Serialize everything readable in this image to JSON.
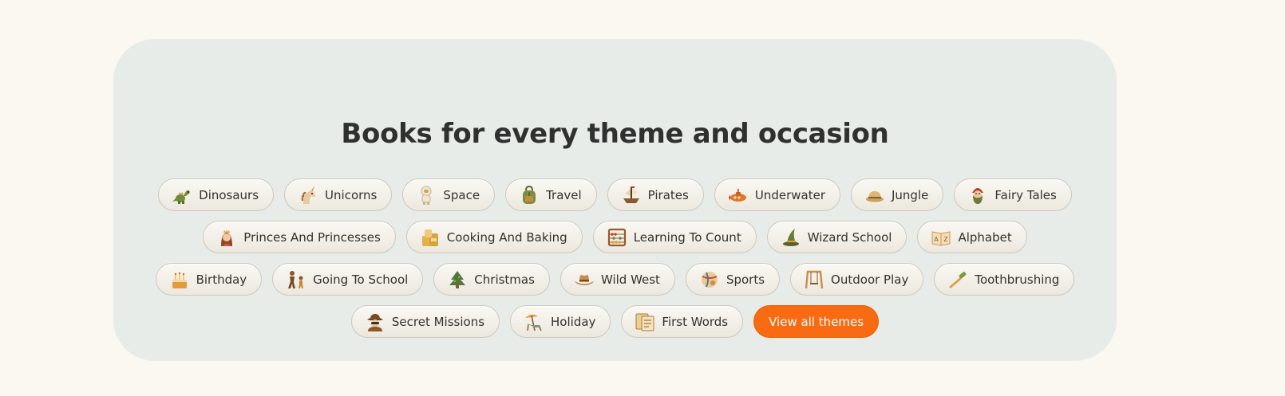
{
  "section": {
    "title": "Books for every theme and occasion",
    "cta_label": "View all themes"
  },
  "colors": {
    "page_background": "#fbf7f1",
    "panel_background": "#e7ece8",
    "title_text": "#2f3131",
    "chip_text": "#35312c",
    "cta_background": "#f96b12"
  },
  "rows": [
    [
      {
        "label": "Dinosaurs",
        "icon": "dinosaur-icon"
      },
      {
        "label": "Unicorns",
        "icon": "unicorn-icon"
      },
      {
        "label": "Space",
        "icon": "astronaut-icon"
      },
      {
        "label": "Travel",
        "icon": "backpack-icon"
      },
      {
        "label": "Pirates",
        "icon": "pirate-ship-icon"
      },
      {
        "label": "Underwater",
        "icon": "submarine-icon"
      },
      {
        "label": "Jungle",
        "icon": "safari-hat-icon"
      },
      {
        "label": "Fairy Tales",
        "icon": "bearded-dwarf-icon"
      }
    ],
    [
      {
        "label": "Princes And Princesses",
        "icon": "princess-icon"
      },
      {
        "label": "Cooking And Baking",
        "icon": "flour-bags-icon"
      },
      {
        "label": "Learning To Count",
        "icon": "abacus-icon"
      },
      {
        "label": "Wizard School",
        "icon": "wizard-hat-icon"
      },
      {
        "label": "Alphabet",
        "icon": "alphabet-book-icon"
      }
    ],
    [
      {
        "label": "Birthday",
        "icon": "birthday-cake-icon"
      },
      {
        "label": "Going To School",
        "icon": "walking-children-icon"
      },
      {
        "label": "Christmas",
        "icon": "christmas-tree-icon"
      },
      {
        "label": "Wild West",
        "icon": "cowboy-hat-icon"
      },
      {
        "label": "Sports",
        "icon": "ball-icon"
      },
      {
        "label": "Outdoor Play",
        "icon": "swing-icon"
      },
      {
        "label": "Toothbrushing",
        "icon": "toothbrush-icon"
      }
    ],
    [
      {
        "label": "Secret Missions",
        "icon": "spy-icon"
      },
      {
        "label": "Holiday",
        "icon": "beach-chair-icon"
      },
      {
        "label": "First Words",
        "icon": "word-cards-icon"
      }
    ]
  ]
}
